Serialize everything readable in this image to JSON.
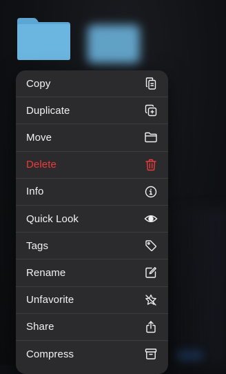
{
  "colors": {
    "folder": "#6bb6e0",
    "menu_background": "#2b2b2d",
    "destructive": "#ee3a3a",
    "text": "#f2f2f4"
  },
  "menu": {
    "items": [
      {
        "label": "Copy",
        "icon": "copy-icon",
        "destructive": false
      },
      {
        "label": "Duplicate",
        "icon": "duplicate-icon",
        "destructive": false
      },
      {
        "label": "Move",
        "icon": "folder-icon",
        "destructive": false
      },
      {
        "label": "Delete",
        "icon": "trash-icon",
        "destructive": true
      },
      {
        "label": "Info",
        "icon": "info-icon",
        "destructive": false
      },
      {
        "label": "Quick Look",
        "icon": "eye-icon",
        "destructive": false
      },
      {
        "label": "Tags",
        "icon": "tag-icon",
        "destructive": false
      },
      {
        "label": "Rename",
        "icon": "pencil-square-icon",
        "destructive": false
      },
      {
        "label": "Unfavorite",
        "icon": "star-slash-icon",
        "destructive": false
      },
      {
        "label": "Share",
        "icon": "share-icon",
        "destructive": false
      },
      {
        "label": "Compress",
        "icon": "archive-box-icon",
        "destructive": false
      }
    ]
  }
}
